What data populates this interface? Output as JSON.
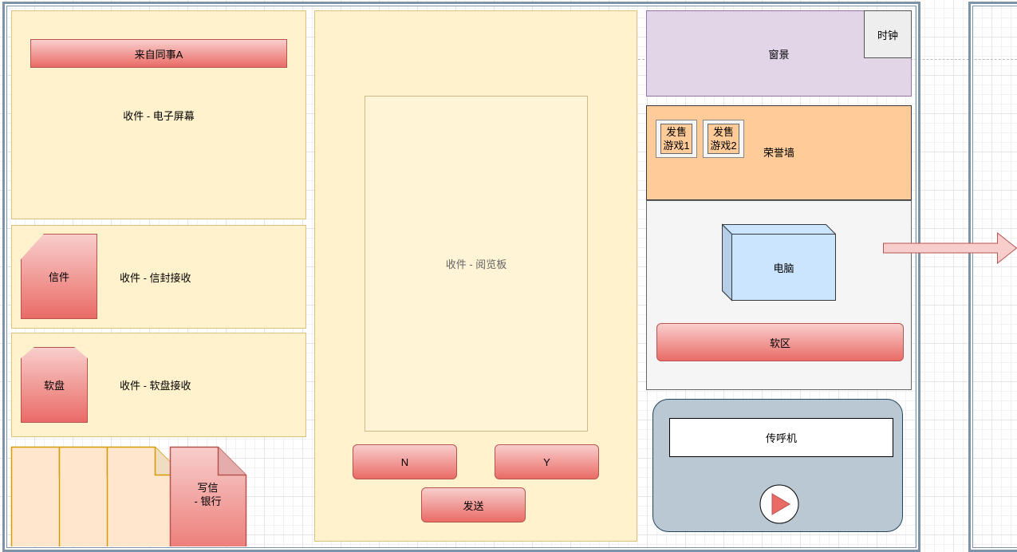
{
  "screen": {
    "from_colleague": "来自同事A",
    "label": "收件 - 电子屏幕"
  },
  "envelope": {
    "shape": "信件",
    "label": "收件 - 信封接收"
  },
  "floppy": {
    "shape": "软盘",
    "label": "收件 - 软盘接收"
  },
  "write": {
    "label": "写信\n- 银行",
    "line1": "写信",
    "line2": "- 银行"
  },
  "reader": {
    "label": "收件 - 阅览板",
    "n": "N",
    "y": "Y",
    "send": "发送"
  },
  "window": {
    "label": "窗景",
    "clock": "时钟"
  },
  "honor": {
    "label": "荣誉墙",
    "games": [
      {
        "l1": "发售",
        "l2": "游戏1"
      },
      {
        "l1": "发售",
        "l2": "游戏2"
      }
    ]
  },
  "computer": {
    "label": "电脑",
    "soft": "软区"
  },
  "pager": {
    "label": "传呼机"
  },
  "colors": {
    "yellow": "#fff2cc",
    "red": "#ea6b66",
    "purple": "#e1d5e7",
    "orange": "#ffcc99",
    "grey": "#f5f5f5",
    "blue": "#cce5ff",
    "pager": "#bac8d3"
  }
}
